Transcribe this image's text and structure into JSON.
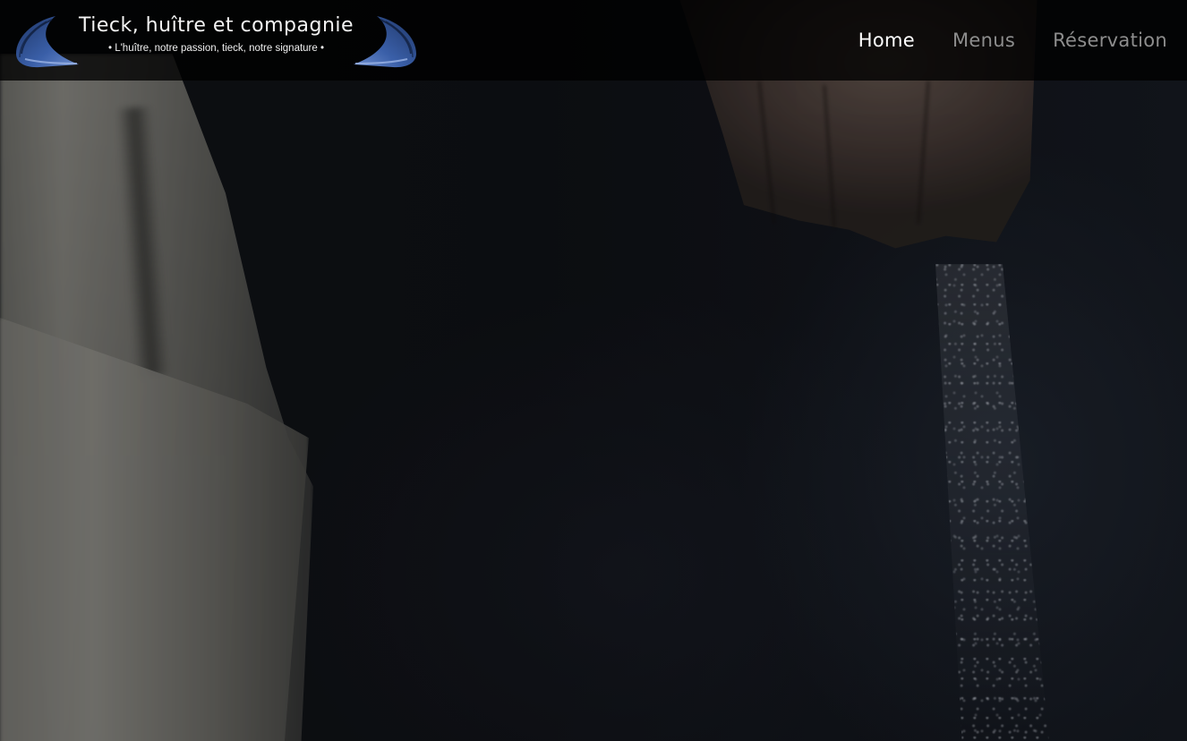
{
  "brand": {
    "title": "Tieck, huître et compagnie",
    "tagline": "• L'huître, notre passion, tieck, notre signature •",
    "logo_icon": "oyster-shell-icon",
    "accent_color": "#3a5fa8"
  },
  "nav": {
    "items": [
      {
        "label": "Home",
        "active": true
      },
      {
        "label": "Menus",
        "active": false
      },
      {
        "label": "Réservation",
        "active": false
      }
    ],
    "active_color": "#ffffff",
    "inactive_color": "#8d8d8d"
  }
}
